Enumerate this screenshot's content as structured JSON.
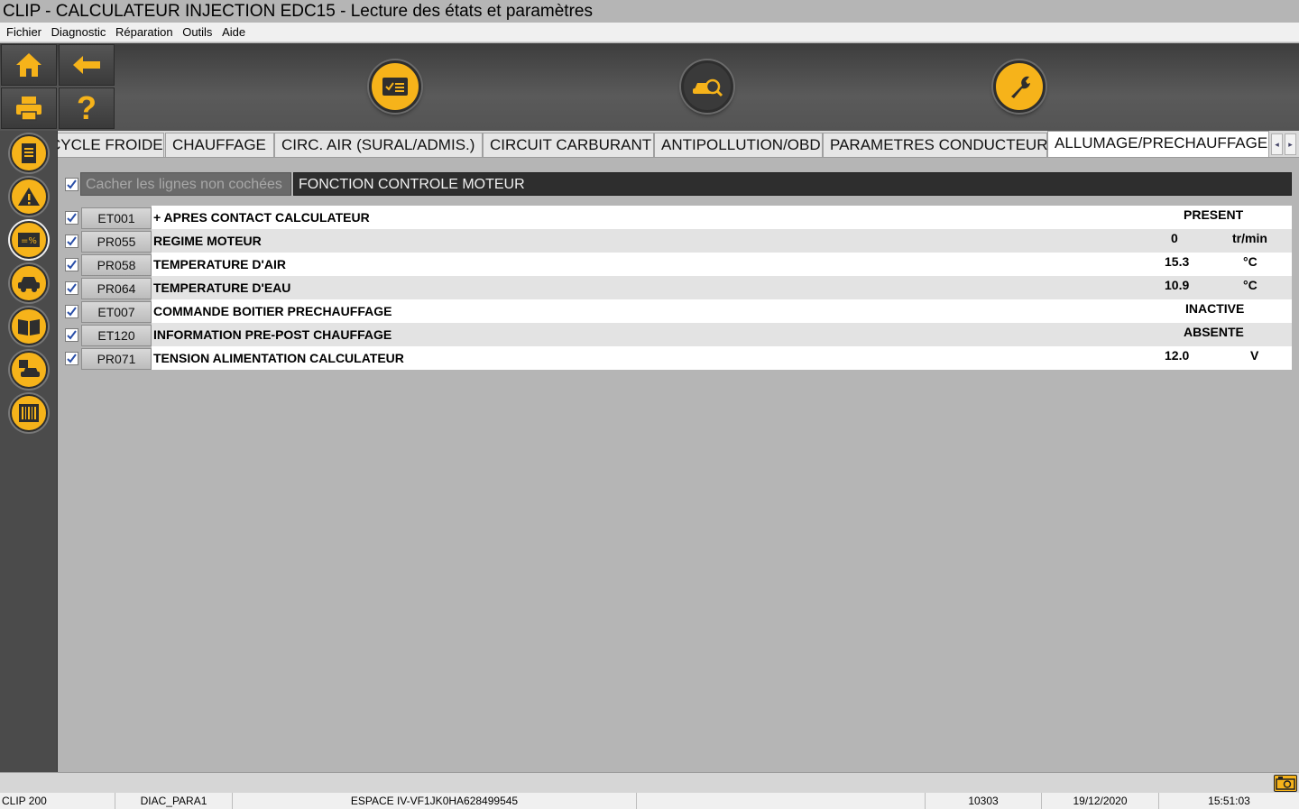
{
  "window": {
    "title": "CLIP - CALCULATEUR INJECTION EDC15 - Lecture des états et paramètres"
  },
  "menu": [
    "Fichier",
    "Diagnostic",
    "Réparation",
    "Outils",
    "Aide"
  ],
  "toolbar": {
    "left_buttons": [
      "home-icon",
      "back-arrow-icon",
      "printer-icon",
      "help-icon"
    ],
    "help_glyph": "?",
    "round_buttons": [
      "checklist-icon",
      "vehicle-diagnostic-icon",
      "wrench-icon"
    ]
  },
  "sidebar": [
    "document-icon",
    "warning-icon",
    "parameters-icon",
    "vehicle-icon",
    "manual-book-icon",
    "vehicle-save-icon",
    "barcode-icon"
  ],
  "tabs": [
    {
      "label": "CYCLE FROIDE"
    },
    {
      "label": "CHAUFFAGE"
    },
    {
      "label": "CIRC. AIR (SURAL/ADMIS.)"
    },
    {
      "label": "CIRCUIT CARBURANT"
    },
    {
      "label": "ANTIPOLLUTION/OBD"
    },
    {
      "label": "PARAMETRES CONDUCTEUR"
    },
    {
      "label": "ALLUMAGE/PRECHAUFFAGE",
      "active": true
    }
  ],
  "tab_arrows": {
    "left": "◂",
    "right": "▸"
  },
  "filter": {
    "hide_unchecked_label": "Cacher les lignes non cochées",
    "checked": true
  },
  "function": {
    "title": "FONCTION CONTROLE MOTEUR"
  },
  "rows": [
    {
      "code": "ET001",
      "label": "+ APRES CONTACT CALCULATEUR",
      "value": "PRESENT",
      "unit": ""
    },
    {
      "code": "PR055",
      "label": "REGIME MOTEUR",
      "value": "0",
      "unit": "tr/min"
    },
    {
      "code": "PR058",
      "label": "TEMPERATURE D'AIR",
      "value": "15.3",
      "unit": "°C"
    },
    {
      "code": "PR064",
      "label": "TEMPERATURE D'EAU",
      "value": "10.9",
      "unit": "°C"
    },
    {
      "code": "ET007",
      "label": "COMMANDE BOITIER PRECHAUFFAGE",
      "value": "INACTIVE",
      "unit": ""
    },
    {
      "code": "ET120",
      "label": "INFORMATION PRE-POST CHAUFFAGE",
      "value": "ABSENTE",
      "unit": ""
    },
    {
      "code": "PR071",
      "label": "TENSION ALIMENTATION CALCULATEUR",
      "value": "12.0",
      "unit": "V"
    }
  ],
  "status": {
    "device": "CLIP 200",
    "screen": "DIAC_PARA1",
    "vehicle": "ESPACE IV-VF1JK0HA628499545",
    "empty": "",
    "code": "10303",
    "date": "19/12/2020",
    "time": "15:51:03"
  },
  "colors": {
    "accent": "#f6b31a",
    "toolbar": "#4b4b4b",
    "background": "#b5b5b5"
  }
}
